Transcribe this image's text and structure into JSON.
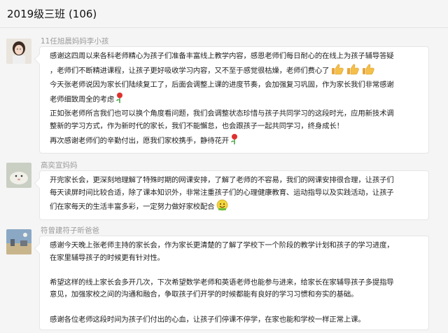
{
  "header": {
    "title": "2019级三班 (106)"
  },
  "messages": [
    {
      "sender": "11任旭晨妈妈李小孩",
      "lines": [
        "感谢这四周以来各科老师精心为孩子们准备丰富线上教学内容，感恩老师们每日耐心的在线上为孩子辅导答疑",
        "，老师们不断精进课程，让孩子更好吸收学习内容，又不至于感觉很枯燥，老师们费心了",
        "今天张老师说因为家长们陆续复工了，后面会调整上课的进度节奏，会加强复习巩固，作为家长我们非常感谢",
        "老师细致周全的考虑",
        "正如张老师所言我们也可以换个角度看问题，我们会调整状态珍惜与孩子共同学习的这段时光，应用新技术调",
        "整新的学习方式，作为新时代的家长，我们不能懈怠，也会跟孩子一起共同学习，终身成长！",
        "再次感谢老师们的辛勤付出，愿我们家校携手，静待花开"
      ]
    },
    {
      "sender": "高奕宣妈妈",
      "lines": [
        "开完家长会，更深刻地理解了特殊时期的网课安排，了解了老师的不容易，我们的网课安排很合理，让孩子们",
        "每天读屏时间比较合适，除了课本知识外，非常注重孩子们的心理健康教育、运动指导以及实践活动，让孩子",
        "们在家每天的生活丰富多彩，一定努力做好家校配合"
      ]
    },
    {
      "sender": "符曾建符子昕爸爸",
      "lines": [
        "感谢今天晚上张老师主持的家长会，作为家长更清楚的了解了学校下一个阶段的教学计划和孩子的学习进度，",
        "在家里辅导孩子的时候更有针对性。",
        "",
        "希望这样的线上家长会多开几次，下次希望数学老师和英语老师也能参与进来，给家长在家辅导孩子多提指导",
        "意见，加强家校之间的沟通和融合，争取孩子们开学的时候都能有良好的学习习惯和夯实的基础。",
        "",
        "感谢各位老师这段时间为孩子们付出的心血，让孩子们停课不停学，在家也能和学校一样正常上课。"
      ]
    }
  ],
  "icons": {
    "thumbs": "thumbs-up-icon",
    "rose": "rose-icon",
    "smile": "smile-icon"
  }
}
